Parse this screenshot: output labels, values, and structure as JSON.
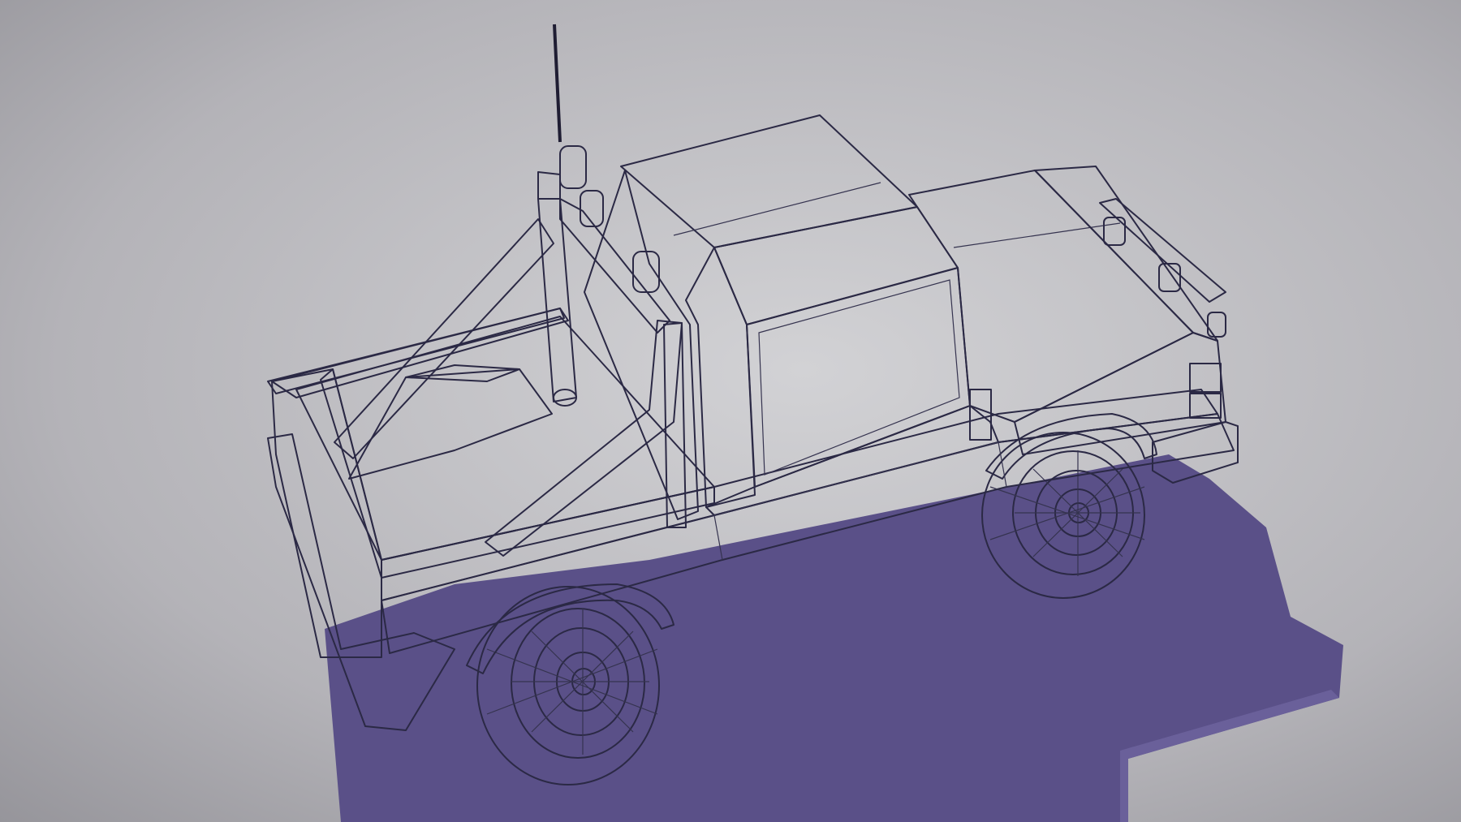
{
  "scene": {
    "subject": "pickup-truck",
    "render_style": "clay-wireframe",
    "colors": {
      "background_light": "#c9c9cc",
      "background_dark": "#8f8e94",
      "model_light": "#ebe8f7",
      "model_mid": "#cfc9ef",
      "model_shadow": "#9e95d6",
      "wire": "#2b2945",
      "cast_shadow": "#5a5088",
      "tire": "#d7d3ee"
    }
  }
}
